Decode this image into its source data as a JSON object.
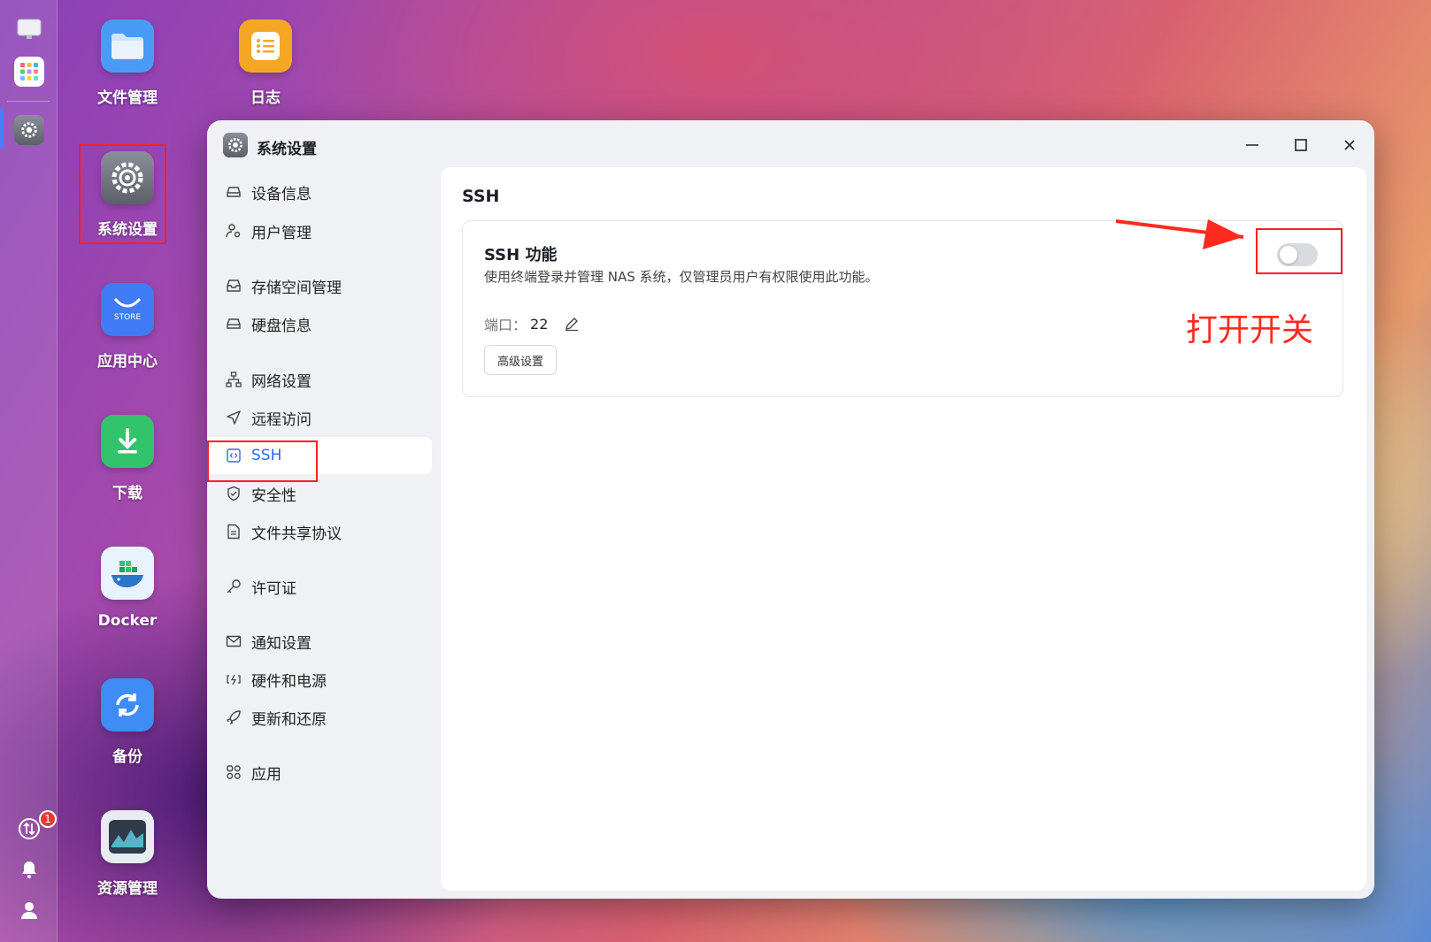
{
  "desktop": {
    "icons": [
      {
        "label": "文件管理",
        "icon": "folder-icon",
        "color": "#4a9bf5"
      },
      {
        "label": "日志",
        "icon": "notes-icon",
        "color": "#f5a623"
      },
      {
        "label": "系统设置",
        "icon": "gear-icon",
        "color": "#6d7079"
      },
      {
        "label": "应用中心",
        "icon": "store-icon",
        "color": "#3f7cf6",
        "text": "STORE"
      },
      {
        "label": "下载",
        "icon": "download-icon",
        "color": "#31c46b"
      },
      {
        "label": "Docker",
        "icon": "docker-icon",
        "color": "#e9f3ff"
      },
      {
        "label": "备份",
        "icon": "sync-icon",
        "color": "#3f8cf6"
      },
      {
        "label": "资源管理",
        "icon": "monitor-chart-icon",
        "color": "#2f3b48"
      }
    ]
  },
  "dock": {
    "notification_count": "1"
  },
  "window": {
    "title": "系统设置",
    "controls": [
      "minimize-icon",
      "maximize-icon",
      "close-icon"
    ]
  },
  "sidebar": {
    "items": [
      {
        "label": "设备信息",
        "icon": "drive-icon"
      },
      {
        "label": "用户管理",
        "icon": "user-gear-icon"
      },
      {
        "label": "存储空间管理",
        "icon": "inbox-icon"
      },
      {
        "label": "硬盘信息",
        "icon": "disk-icon"
      },
      {
        "label": "网络设置",
        "icon": "network-icon"
      },
      {
        "label": "远程访问",
        "icon": "send-icon"
      },
      {
        "label": "SSH",
        "icon": "code-box-icon",
        "active": true
      },
      {
        "label": "安全性",
        "icon": "shield-icon"
      },
      {
        "label": "文件共享协议",
        "icon": "document-icon"
      },
      {
        "label": "许可证",
        "icon": "key-icon"
      },
      {
        "label": "通知设置",
        "icon": "mail-icon"
      },
      {
        "label": "硬件和电源",
        "icon": "power-icon"
      },
      {
        "label": "更新和还原",
        "icon": "rocket-icon"
      },
      {
        "label": "应用",
        "icon": "apps-icon"
      }
    ]
  },
  "main": {
    "heading": "SSH",
    "card": {
      "title": "SSH 功能",
      "description": "使用终端登录并管理 NAS 系统，仅管理员用户有权限使用此功能。",
      "port_label": "端口：",
      "port_value": "22",
      "advanced_button": "高级设置",
      "toggle_on": false
    }
  },
  "annotation": {
    "text": "打开开关",
    "color": "#ff2a1f"
  }
}
